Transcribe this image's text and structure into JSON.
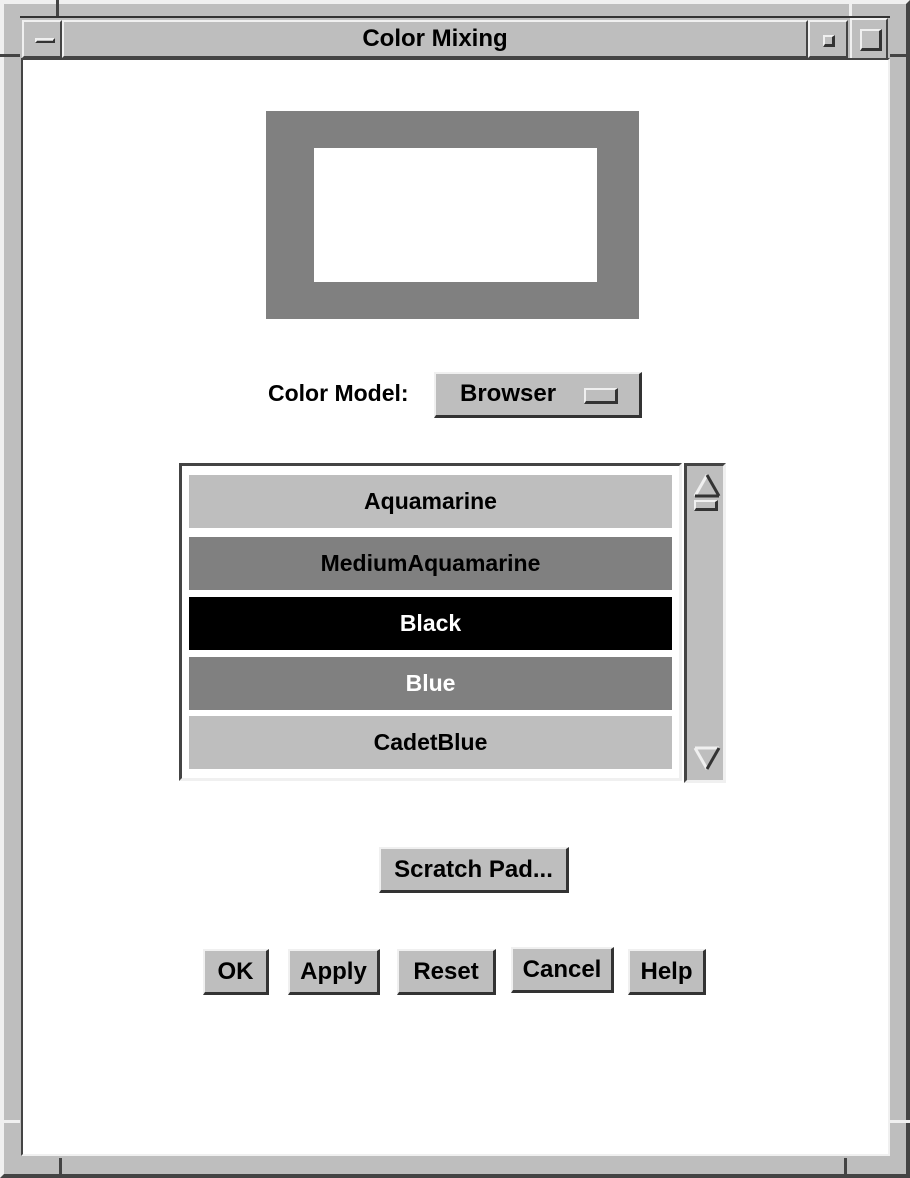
{
  "window": {
    "title": "Color Mixing",
    "controls": {
      "menu_icon": "window-menu-icon",
      "minimize_icon": "minimize-icon",
      "maximize_icon": "maximize-icon"
    }
  },
  "preview": {
    "border_color": "#808080",
    "center_color": "#ffffff"
  },
  "color_model": {
    "label": "Color Model:",
    "selected": "Browser",
    "menu_icon": "option-menu-icon"
  },
  "color_list": {
    "items": [
      {
        "label": "Aquamarine",
        "background": "#bebebe",
        "text_color": "#000000"
      },
      {
        "label": "MediumAquamarine",
        "background": "#808080",
        "text_color": "#000000"
      },
      {
        "label": "Black",
        "background": "#000000",
        "text_color": "#ffffff"
      },
      {
        "label": "Blue",
        "background": "#808080",
        "text_color": "#ffffff"
      },
      {
        "label": "CadetBlue",
        "background": "#bebebe",
        "text_color": "#000000"
      }
    ],
    "scroll_up_icon": "arrow-up-icon",
    "scroll_down_icon": "arrow-down-icon"
  },
  "scratch_pad": {
    "label": "Scratch Pad..."
  },
  "actions": {
    "ok": "OK",
    "apply": "Apply",
    "reset": "Reset",
    "cancel": "Cancel",
    "help": "Help"
  },
  "theme": {
    "widget_bg": "#bebebe",
    "shadow_dark": "#333333",
    "shadow_light": "#f0f0f0"
  }
}
